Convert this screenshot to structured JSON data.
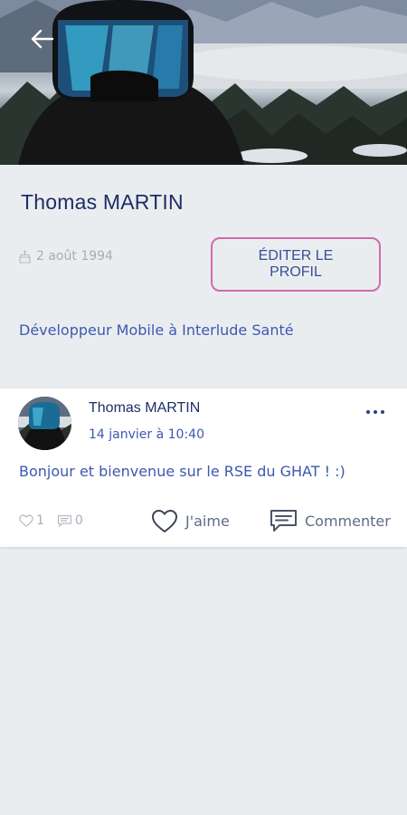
{
  "header": {
    "back_icon": "arrow-left-icon"
  },
  "profile": {
    "name": "Thomas MARTIN",
    "birth_icon": "cake-icon",
    "birth_date": "2 août 1994",
    "edit_button_label": "ÉDITER LE PROFIL",
    "job": "Développeur Mobile à Interlude Santé"
  },
  "post": {
    "author": "Thomas MARTIN",
    "date": "14 janvier à 10:40",
    "more_icon": "more-horizontal-icon",
    "text": "Bonjour et bienvenue sur le RSE du GHAT ! :)",
    "likes_count": "1",
    "comments_count": "0",
    "like_label": "J'aime",
    "comment_label": "Commenter"
  },
  "colors": {
    "background": "#eaedf0",
    "primary_text": "#1f2d66",
    "link_blue": "#3c59b0",
    "accent_pink": "#d06aa7",
    "muted": "#a7adb7"
  }
}
